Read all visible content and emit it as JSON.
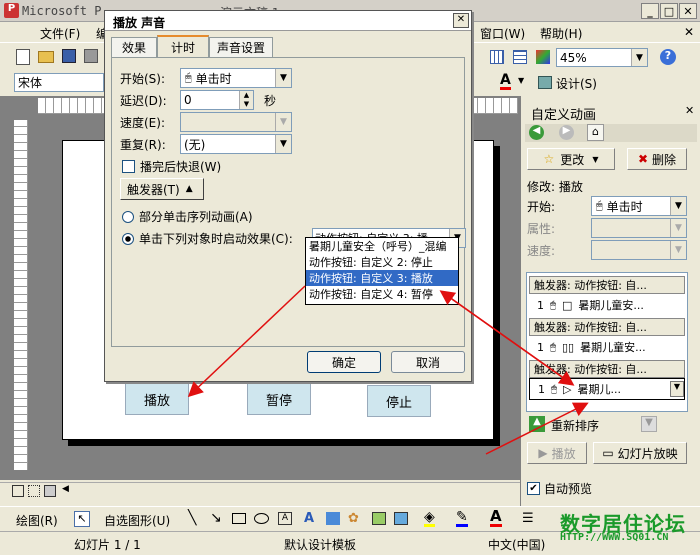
{
  "app": {
    "title": "Microsoft P",
    "title_suffix": "演示文稿 1"
  },
  "menubar": {
    "items": [
      "文件(F)",
      "编",
      "窗口(W)",
      "帮助(H)"
    ]
  },
  "toolbar": {
    "zoom": "45%",
    "font_name": "宋体",
    "design_label": "设计(S)"
  },
  "dialog": {
    "title": "播放 声音",
    "tabs": [
      "效果",
      "计时",
      "声音设置"
    ],
    "active_tab": "计时",
    "fields": {
      "start_label": "开始(S):",
      "start_value": "单击时",
      "delay_label": "延迟(D):",
      "delay_value": "0",
      "delay_unit": "秒",
      "speed_label": "速度(E):",
      "speed_value": "",
      "repeat_label": "重复(R):",
      "repeat_value": "(无)",
      "rewind_label": "播完后快退(W)"
    },
    "trigger_button": "触发器(T)",
    "radio_sequence": "部分单击序列动画(A)",
    "radio_click_object": "单击下列对象时启动效果(C):",
    "trigger_selected": "动作按钮: 自定义 3: 播",
    "trigger_options": [
      "暑期儿童安全（呼号）_混编",
      "动作按钮: 自定义 2: 停止",
      "动作按钮: 自定义 3: 播放",
      "动作按钮: 自定义 4: 暂停"
    ],
    "ok": "确定",
    "cancel": "取消"
  },
  "slide": {
    "buttons": {
      "play": "播放",
      "pause": "暂停",
      "stop": "停止"
    }
  },
  "task_pane": {
    "title": "自定义动画",
    "change_button": "更改",
    "delete_button": "删除",
    "modify_label": "修改: 播放",
    "start_label": "开始:",
    "start_value": "单击时",
    "property_label": "属性:",
    "speed_label": "速度:",
    "groups": [
      {
        "trigger": "触发器: 动作按钮: 自...",
        "num": "1",
        "symbol": "□",
        "text": "暑期儿童安..."
      },
      {
        "trigger": "触发器: 动作按钮: 自...",
        "num": "1",
        "symbol": "▯▯",
        "text": "暑期儿童安..."
      },
      {
        "trigger": "触发器: 动作按钮: 自...",
        "num": "1",
        "symbol": "▷",
        "text": "暑期儿..."
      }
    ],
    "reorder_label": "重新排序",
    "play_button": "播放",
    "slideshow_button": "幻灯片放映",
    "autopreview_label": "自动预览"
  },
  "drawing_bar": {
    "draw_label": "绘图(R)",
    "autoshape_label": "自选图形(U)"
  },
  "status_bar": {
    "slide": "幻灯片 1 / 1",
    "design": "默认设计模板",
    "language": "中文(中国)"
  },
  "watermark": {
    "text": "数字居住论坛",
    "url": "HTTP://WWW.SQ01.CN"
  },
  "colors": {
    "selection": "#316ac5",
    "arrow": "#e01010",
    "button_fill": "#cfe6ee",
    "watermark": "#1a9a2a"
  }
}
